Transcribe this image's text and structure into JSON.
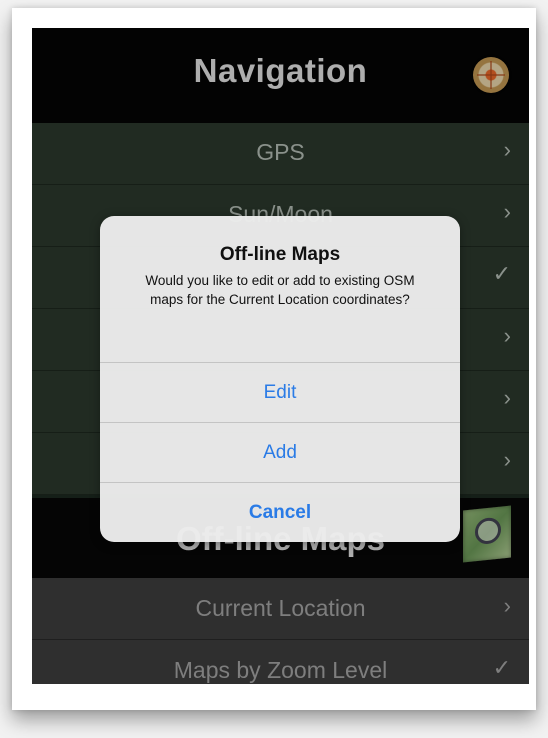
{
  "nav": {
    "title": "Navigation",
    "rows": [
      {
        "label": "GPS",
        "accessory": "›"
      },
      {
        "label": "Sun/Moon",
        "accessory": "›"
      },
      {
        "label": "",
        "accessory": "✓"
      },
      {
        "label": "",
        "accessory": "›"
      },
      {
        "label": "",
        "accessory": "›"
      },
      {
        "label": "",
        "accessory": "›"
      }
    ]
  },
  "section": {
    "title": "Off-line Maps"
  },
  "maps": {
    "rows": [
      {
        "label": "Current Location",
        "accessory": "›"
      },
      {
        "label": "Maps by Zoom Level",
        "accessory": "✓"
      }
    ]
  },
  "alert": {
    "title": "Off-line Maps",
    "message": "Would you like to edit or add to existing OSM maps for the Current Location coordinates?",
    "buttons": {
      "edit": "Edit",
      "add": "Add",
      "cancel": "Cancel"
    }
  },
  "colors": {
    "accent": "#2a7be6",
    "nav_row_bg": "#2c3a2e",
    "header_bg": "#040404"
  }
}
